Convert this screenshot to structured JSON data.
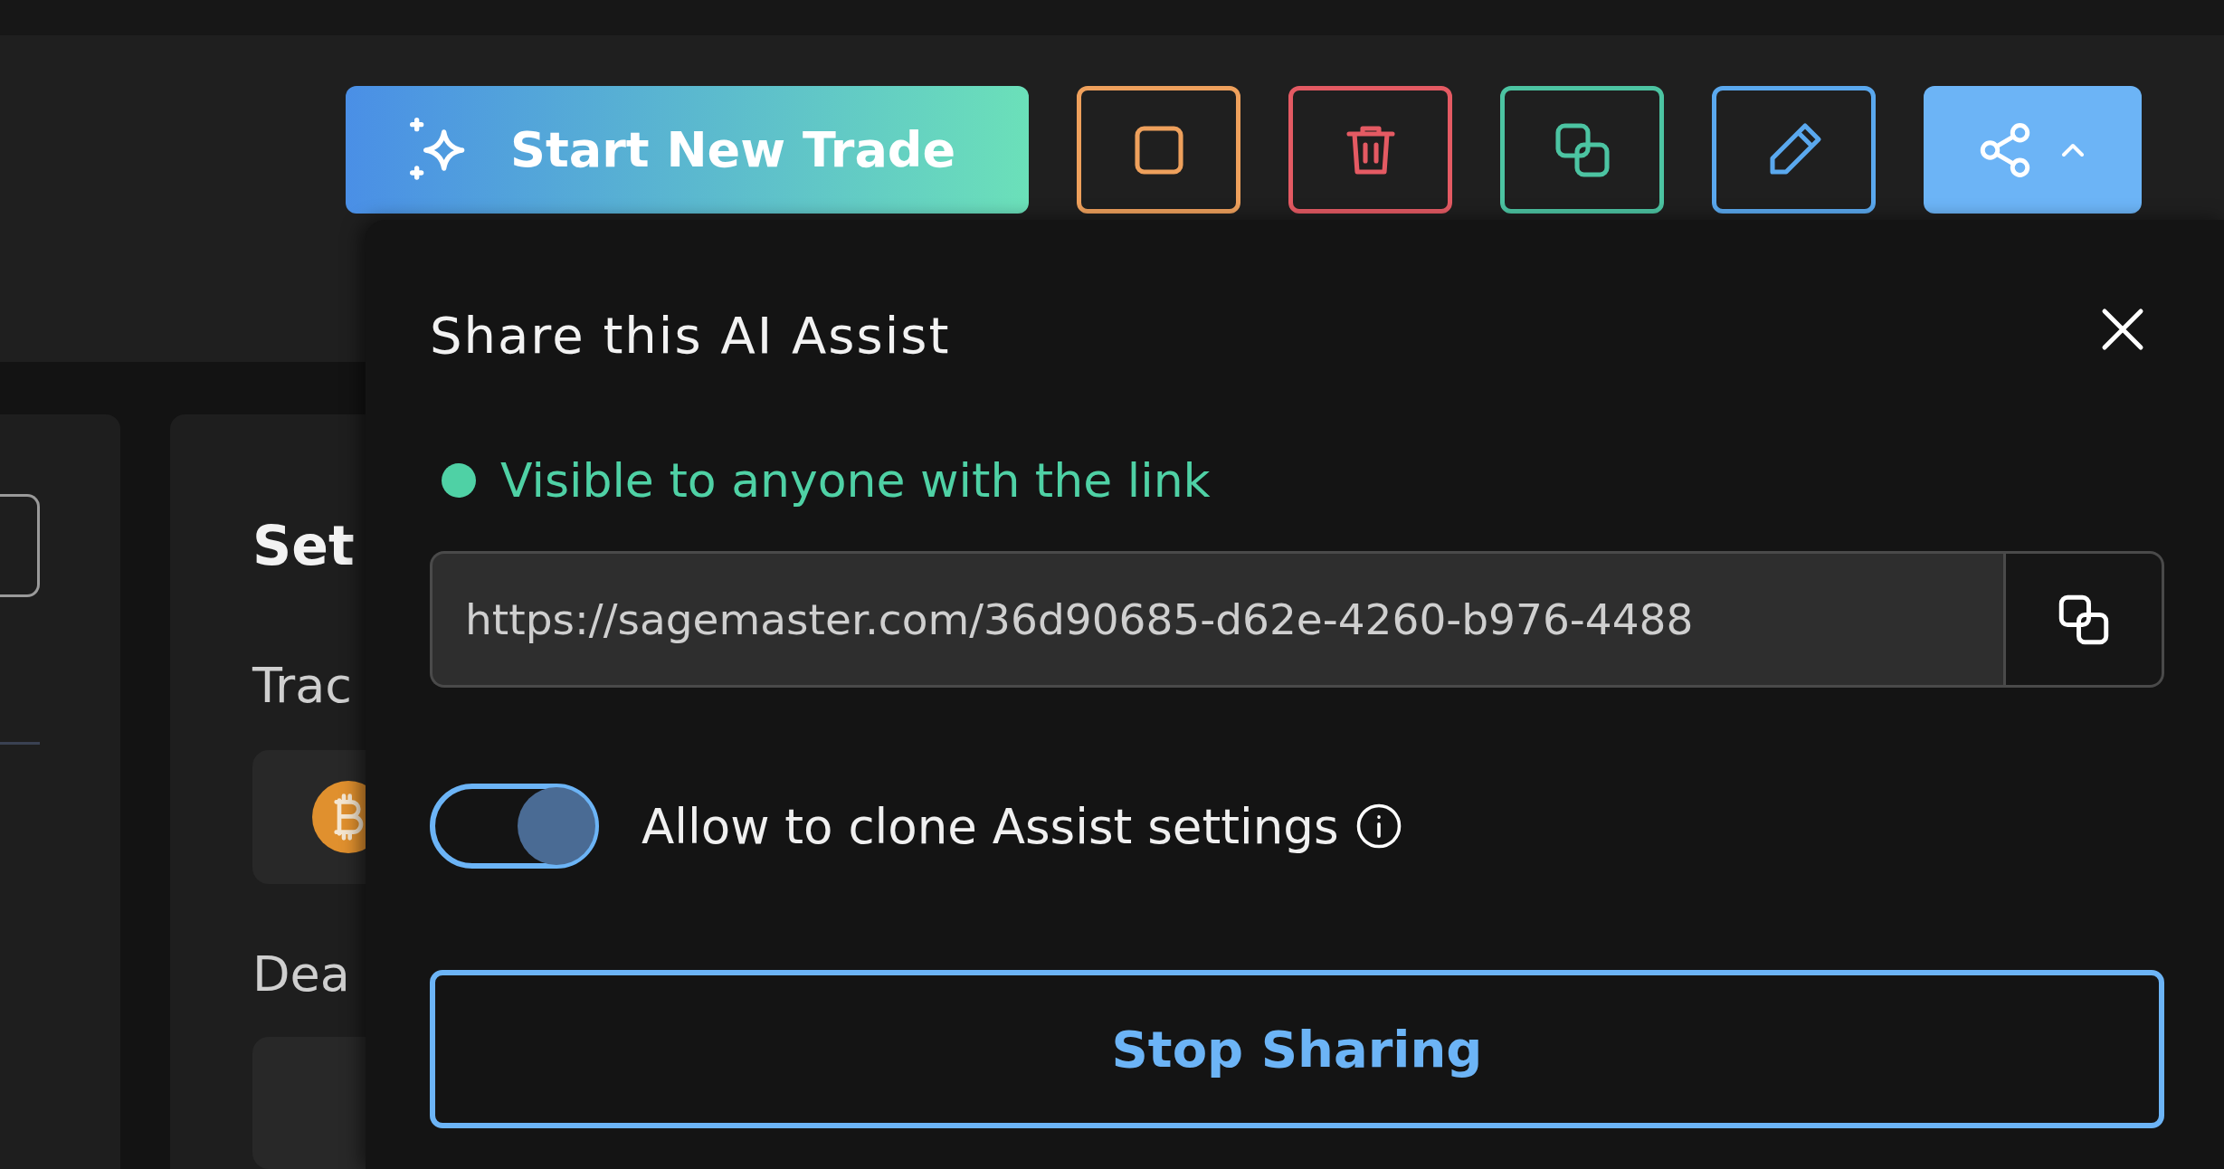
{
  "toolbar": {
    "start_button": {
      "label": "Start New Trade"
    },
    "icon_buttons": [
      {
        "kind": "stop",
        "color": "#eea05c"
      },
      {
        "kind": "delete",
        "color": "#e45a63"
      },
      {
        "kind": "duplicate",
        "color": "#4cc4a2"
      },
      {
        "kind": "edit",
        "color": "#5aa8ee"
      }
    ],
    "share_button": {
      "expanded": true
    }
  },
  "background": {
    "settings_title": "Set",
    "trading_label": "Trac",
    "deal_label": "Dea"
  },
  "share_popover": {
    "title": "Share this AI Assist",
    "status": {
      "text": "Visible to anyone with the link",
      "color": "#4fd1a5"
    },
    "link_field": {
      "value": "https://sagemaster.com/36d90685-d62e-4260-b976-4488"
    },
    "clone_toggle": {
      "label": "Allow to clone Assist settings",
      "on": true
    },
    "stop_button": {
      "label": "Stop Sharing"
    }
  }
}
